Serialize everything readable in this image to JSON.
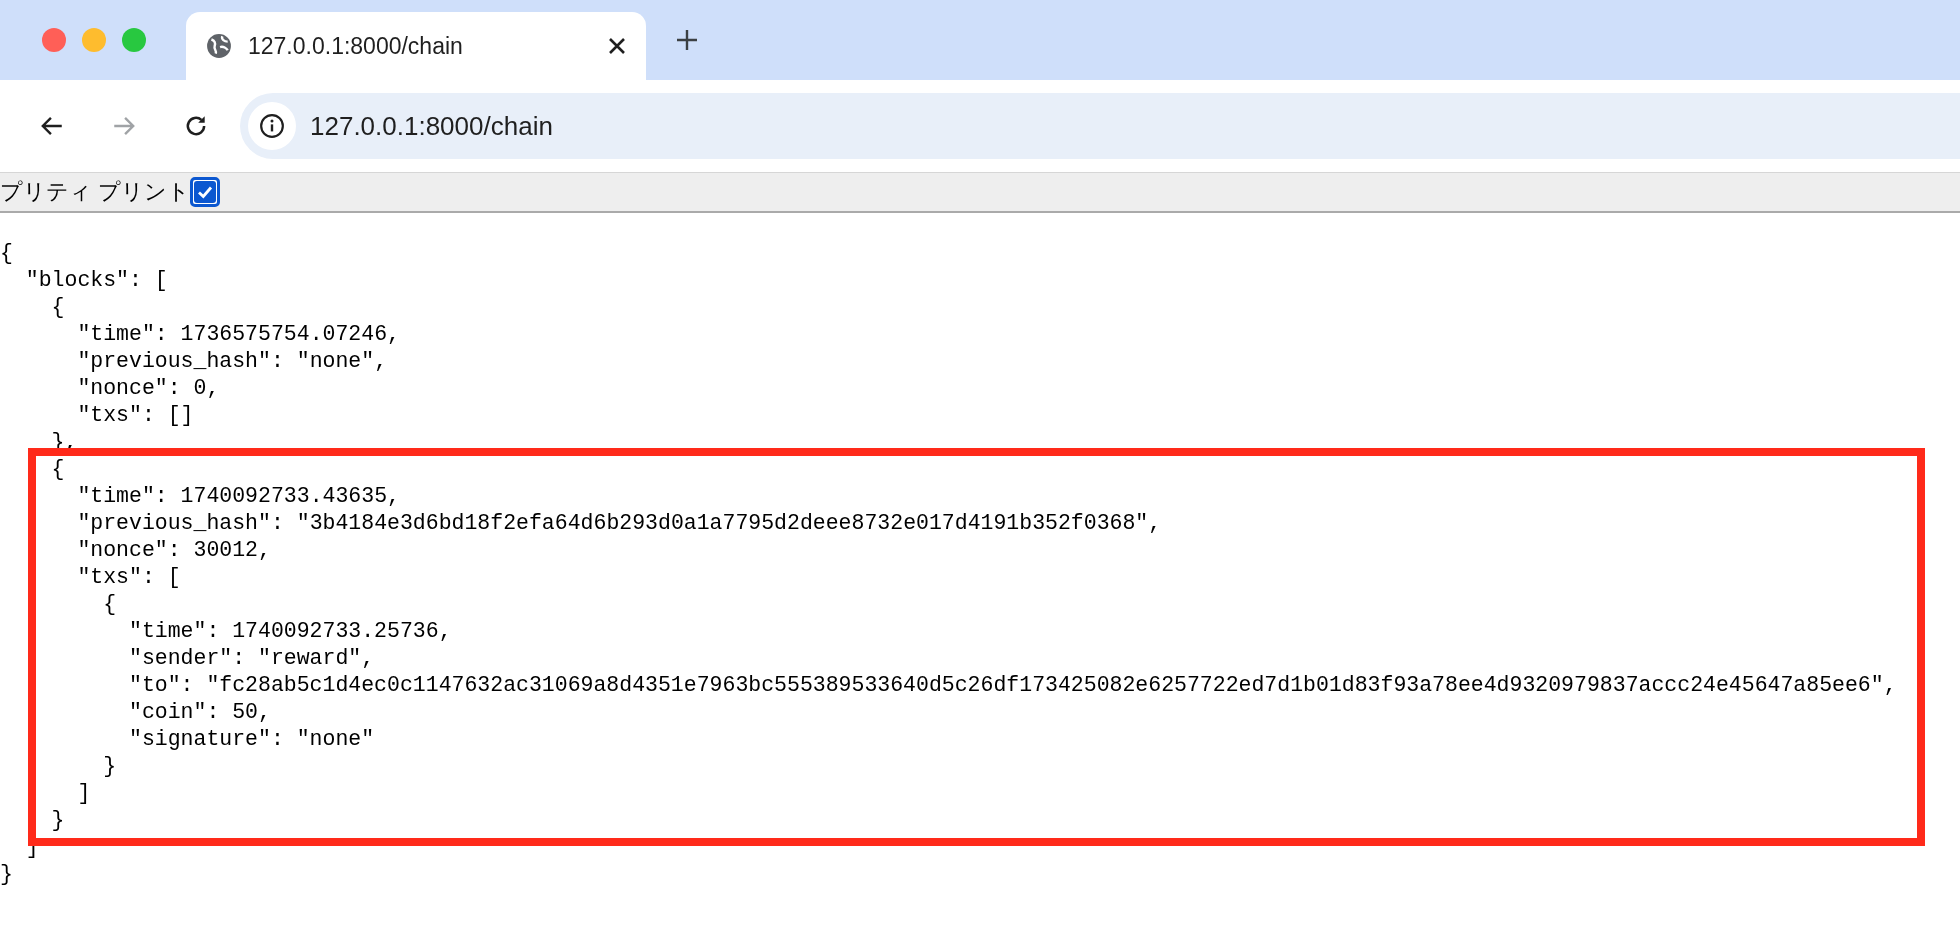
{
  "browser": {
    "tab": {
      "title": "127.0.0.1:8000/chain",
      "selected": true
    },
    "nav": [
      {
        "kind": "back",
        "disabled": false
      },
      {
        "kind": "forward",
        "disabled": true
      },
      {
        "kind": "reload",
        "disabled": false
      }
    ],
    "address": "127.0.0.1:8000/chain"
  },
  "pretty_print": {
    "label": "プリティ プリント",
    "checked": true
  },
  "json_view": {
    "open": "{",
    "highlighted": false,
    "close": "}",
    "children": [
      {
        "open": "\"blocks\": [",
        "highlighted": false,
        "close": "]",
        "children": [
          {
            "open": "{",
            "highlighted": false,
            "close": "},",
            "children": [
              {
                "text": "\"time\": 1736575754.07246,"
              },
              {
                "text": "\"previous_hash\": \"none\","
              },
              {
                "text": "\"nonce\": 0,"
              },
              {
                "text": "\"txs\": []"
              }
            ]
          },
          {
            "open": "{",
            "highlighted": true,
            "close": "}",
            "children": [
              {
                "text": "\"time\": 1740092733.43635,"
              },
              {
                "text": "\"previous_hash\": \"3b4184e3d6bd18f2efa64d6b293d0a1a7795d2deee8732e017d4191b352f0368\","
              },
              {
                "text": "\"nonce\": 30012,"
              },
              {
                "open": "\"txs\": [",
                "highlighted": false,
                "close": "]",
                "children": [
                  {
                    "open": "{",
                    "highlighted": false,
                    "close": "}",
                    "children": [
                      {
                        "text": "\"time\": 1740092733.25736,"
                      },
                      {
                        "text": "\"sender\": \"reward\","
                      },
                      {
                        "text": "\"to\": \"fc28ab5c1d4ec0c1147632ac31069a8d4351e7963bc555389533640d5c26df173425082e6257722ed7d1b01d83f93a78ee4d9320979837accc24e45647a85ee6\","
                      },
                      {
                        "text": "\"coin\": 50,"
                      },
                      {
                        "text": "\"signature\": \"none\""
                      }
                    ]
                  }
                ]
              }
            ]
          }
        ]
      }
    ]
  }
}
